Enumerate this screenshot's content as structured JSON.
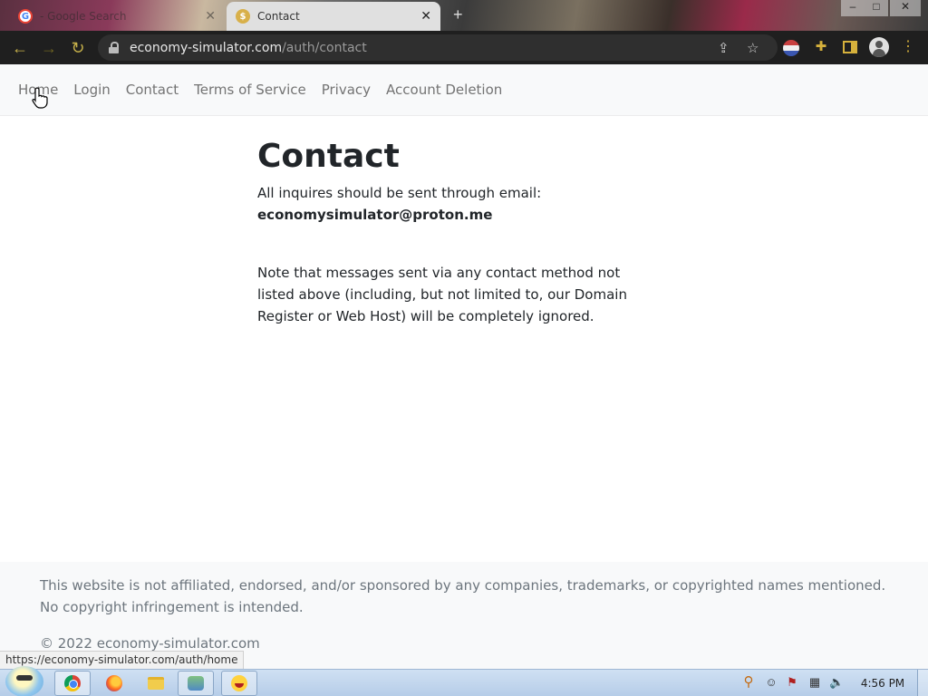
{
  "browser": {
    "tabs": [
      {
        "title": "- Google Search",
        "active": false,
        "favicon": "google-icon"
      },
      {
        "title": "Contact",
        "active": true,
        "favicon": "site-favicon"
      }
    ],
    "new_tab_icon": "+",
    "window_controls": {
      "minimize": "–",
      "maximize": "□",
      "close": "✕"
    },
    "url_host": "economy-simulator.com",
    "url_path": "/auth/contact"
  },
  "nav": {
    "items": [
      "Home",
      "Login",
      "Contact",
      "Terms of Service",
      "Privacy",
      "Account Deletion"
    ]
  },
  "main": {
    "title": "Contact",
    "intro": "All inquires should be sent through email:",
    "email": "economysimulator@proton.me",
    "note": "Note that messages sent via any contact method not listed above (including, but not limited to, our Domain Register or Web Host) will be completely ignored."
  },
  "footer": {
    "disclaimer": "This website is not affiliated, endorsed, and/or sponsored by any companies, trademarks, or copyrighted names mentioned. No copyright infringement is intended.",
    "copyright": "© 2022 economy-simulator.com"
  },
  "status_url": "https://economy-simulator.com/auth/home",
  "taskbar": {
    "apps": [
      "chrome-icon",
      "firefox-icon",
      "folder-icon",
      "people-icon",
      "emoji-icon"
    ],
    "clock": "4:56 PM"
  }
}
